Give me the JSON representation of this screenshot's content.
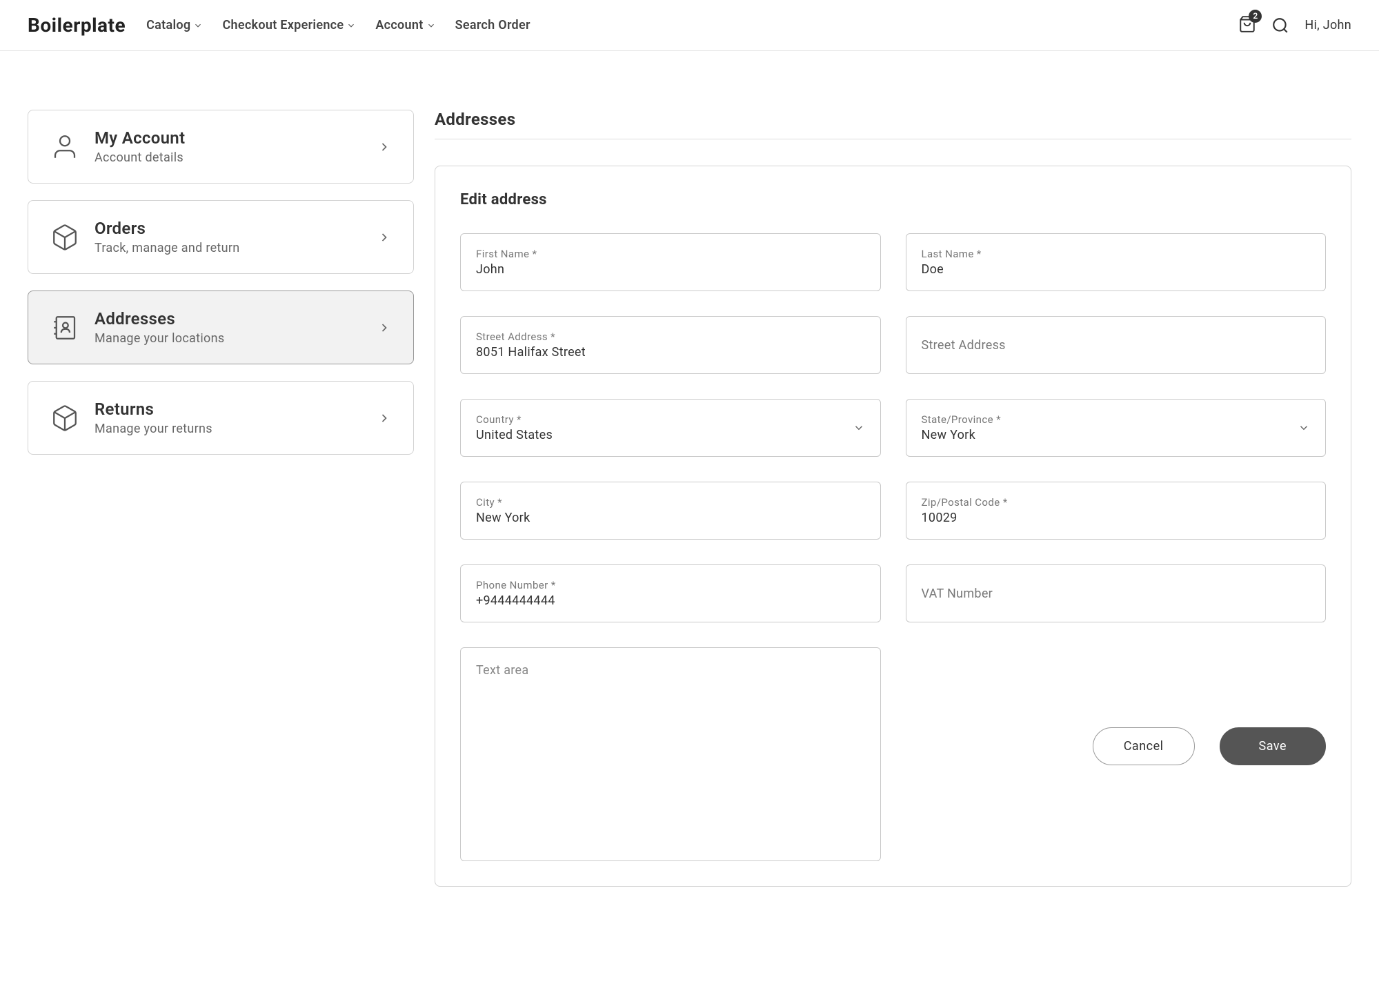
{
  "header": {
    "logo": "Boilerplate",
    "nav": [
      {
        "label": "Catalog",
        "has_dropdown": true
      },
      {
        "label": "Checkout Experience",
        "has_dropdown": true
      },
      {
        "label": "Account",
        "has_dropdown": true
      },
      {
        "label": "Search Order",
        "has_dropdown": false
      }
    ],
    "cart_count": "2",
    "greeting": "Hi, John"
  },
  "sidebar": {
    "items": [
      {
        "title": "My Account",
        "subtitle": "Account details"
      },
      {
        "title": "Orders",
        "subtitle": "Track, manage and return"
      },
      {
        "title": "Addresses",
        "subtitle": "Manage your locations"
      },
      {
        "title": "Returns",
        "subtitle": "Manage your returns"
      }
    ]
  },
  "page": {
    "title": "Addresses",
    "card_title": "Edit address"
  },
  "form": {
    "first_name": {
      "label": "First Name *",
      "value": "John"
    },
    "last_name": {
      "label": "Last Name *",
      "value": "Doe"
    },
    "street1": {
      "label": "Street Address *",
      "value": "8051 Halifax Street"
    },
    "street2": {
      "placeholder": "Street Address"
    },
    "country": {
      "label": "Country *",
      "value": "United States"
    },
    "state": {
      "label": "State/Province *",
      "value": "New York"
    },
    "city": {
      "label": "City *",
      "value": "New York"
    },
    "zip": {
      "label": "Zip/Postal Code *",
      "value": "10029"
    },
    "phone": {
      "label": "Phone Number *",
      "value": "+9444444444"
    },
    "vat": {
      "placeholder": "VAT Number"
    },
    "textarea": {
      "placeholder": "Text area"
    }
  },
  "buttons": {
    "cancel": "Cancel",
    "save": "Save"
  }
}
